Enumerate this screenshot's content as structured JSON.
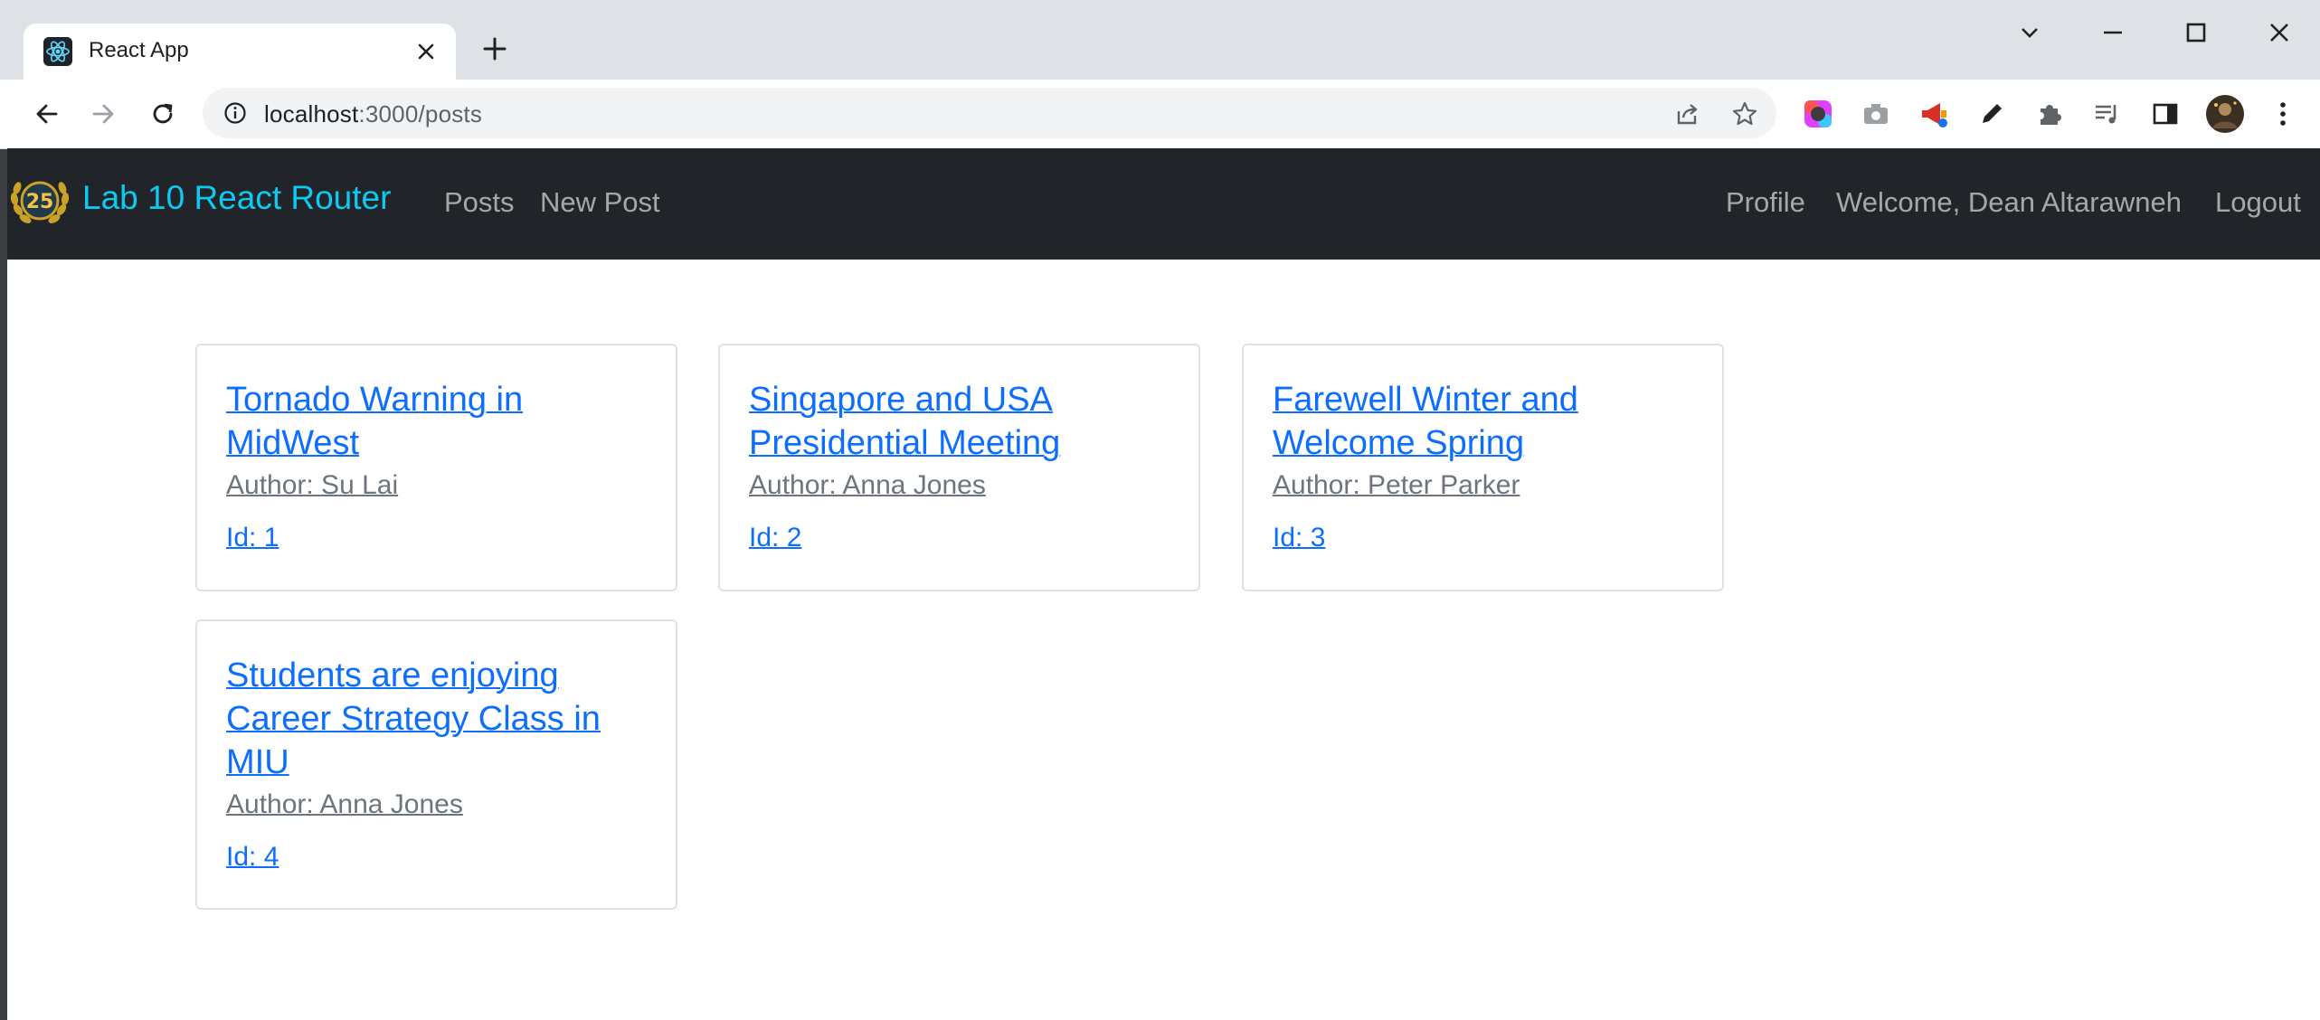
{
  "browser": {
    "tab_title": "React App",
    "url_host": "localhost",
    "url_path": ":3000/posts"
  },
  "navbar": {
    "brand": "Lab 10 React Router",
    "links": [
      "Posts",
      "New Post"
    ],
    "right_links": [
      "Profile",
      "Welcome, Dean Altarawneh",
      "Logout"
    ]
  },
  "posts": [
    {
      "title": "Tornado Warning in MidWest",
      "author": "Author: Su Lai",
      "id": "Id: 1"
    },
    {
      "title": "Singapore and USA Presidential Meeting",
      "author": "Author: Anna Jones",
      "id": "Id: 2"
    },
    {
      "title": "Farewell Winter and Welcome Spring",
      "author": "Author: Peter Parker",
      "id": "Id: 3"
    },
    {
      "title": "Students are enjoying Career Strategy Class in MIU",
      "author": "Author: Anna Jones",
      "id": "Id: 4"
    }
  ],
  "logo": {
    "badge_text": "25"
  },
  "colors": {
    "navbar_bg": "#212529",
    "brand": "#0dcaf0",
    "link": "#0d6efd",
    "muted": "#6c757d"
  }
}
